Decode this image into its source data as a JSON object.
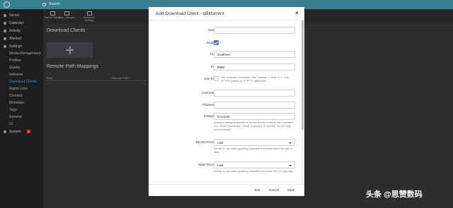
{
  "topbar": {
    "search_placeholder": "Search"
  },
  "sidebar": {
    "items": [
      {
        "label": "Series",
        "icon": "tv-icon"
      },
      {
        "label": "Calendar",
        "icon": "calendar-icon"
      },
      {
        "label": "Activity",
        "icon": "clock-icon"
      },
      {
        "label": "Wanted",
        "icon": "warning-icon"
      },
      {
        "label": "Settings",
        "icon": "gear-icon"
      }
    ],
    "settings_items": [
      "Media Management",
      "Profiles",
      "Quality",
      "Indexers",
      "Download Clients",
      "Import Lists",
      "Connect",
      "Metadata",
      "Tags",
      "General",
      "UI"
    ],
    "active_settings_item": "Download Clients",
    "system": {
      "label": "System",
      "badge": "!"
    }
  },
  "toolbar": {
    "buttons": [
      "Test All Clients",
      "Save Changes",
      "Advanced Settings"
    ]
  },
  "main": {
    "download_clients_title": "Download Clients",
    "remote_path_title": "Remote Path Mappings",
    "headers": [
      "Host",
      "Remote Path"
    ]
  },
  "modal": {
    "title": "Add Download Client - qBittorrent",
    "fields": {
      "name": {
        "label": "Name",
        "value": ""
      },
      "enable": {
        "label": "Enable",
        "checked": true
      },
      "host": {
        "label": "Host",
        "value": "localhost"
      },
      "port": {
        "label": "Port",
        "value": "8080"
      },
      "use_ssl": {
        "label": "Use SSL",
        "checked": false,
        "help": "Use a secure connection. See Options -> Web UI -> 'Use HTTPS instead of HTTP' in qBittorrent."
      },
      "username": {
        "label": "Username",
        "value": ""
      },
      "password": {
        "label": "Password",
        "value": ""
      },
      "category": {
        "label": "Category",
        "value": "tv-sonarr",
        "help": "Adding a category specific to Sonarr avoids conflicts with unrelated non-Sonarr downloads. Using a category is optional, but strongly recommended."
      },
      "recent_priority": {
        "label": "Recent Priority",
        "value": "Last",
        "help": "Priority to use when grabbing episodes that aired within the last 14 days"
      },
      "older_priority": {
        "label": "Older Priority",
        "value": "Last",
        "help": "Priority to use when grabbing episodes that aired over 14 days ago"
      }
    },
    "footer": {
      "test": "Test",
      "cancel": "Cancel",
      "save": "Save"
    }
  },
  "colors": {
    "accent": "#2f86c9",
    "topbar": "#3a7f8f",
    "danger": "#c83737"
  },
  "watermark": "头条 @思赞数码"
}
